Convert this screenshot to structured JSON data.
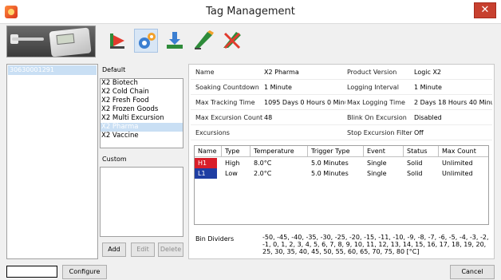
{
  "window": {
    "title": "Tag Management",
    "close_glyph": "✕",
    "app_icon": "app-icon"
  },
  "toolbar": {
    "tools": [
      {
        "name": "chart-icon"
      },
      {
        "name": "settings-icon"
      },
      {
        "name": "download-icon"
      },
      {
        "name": "edit-icon"
      },
      {
        "name": "clear-icon"
      }
    ],
    "active_index": 1
  },
  "tags": {
    "selected": "30630001291"
  },
  "profiles": {
    "default_label": "Default",
    "default_items": [
      "X2 Biotech",
      "X2 Cold Chain",
      "X2 Fresh Food",
      "X2 Frozen Goods",
      "X2 Multi Excursion",
      "X2 Pharma",
      "X2 Vaccine"
    ],
    "selected_index": 5,
    "custom_label": "Custom",
    "add_label": "Add",
    "edit_label": "Edit",
    "delete_label": "Delete"
  },
  "details": {
    "name_label": "Name",
    "name_value": "X2 Pharma",
    "product_version_label": "Product Version",
    "product_version_value": "Logic X2",
    "soaking_label": "Soaking Countdown",
    "soaking_value": "1 Minute",
    "logging_interval_label": "Logging Interval",
    "logging_interval_value": "1 Minute",
    "max_tracking_label": "Max Tracking Time",
    "max_tracking_value": "1095 Days 0 Hours 0 Minut",
    "max_logging_label": "Max Logging Time",
    "max_logging_value": "2 Days 18 Hours 40 Minute",
    "max_excursion_label": "Max Excursion Count",
    "max_excursion_value": "48",
    "blink_label": "Blink On Excursion",
    "blink_value": "Disabled",
    "excursions_label": "Excursions",
    "stop_filter_label": "Stop Excursion Filter",
    "stop_filter_value": "Off"
  },
  "excursion_table": {
    "headers": [
      "Name",
      "Type",
      "Temperature",
      "Trigger Type",
      "Event",
      "Status",
      "Max Count"
    ],
    "rows": [
      {
        "name": "H1",
        "type": "High",
        "temperature": "8.0°C",
        "trigger": "5.0 Minutes",
        "event": "Single",
        "status": "Solid",
        "max_count": "Unlimited"
      },
      {
        "name": "L1",
        "type": "Low",
        "temperature": "2.0°C",
        "trigger": "5.0 Minutes",
        "event": "Single",
        "status": "Solid",
        "max_count": "Unlimited"
      }
    ],
    "colors": {
      "high": "#d81e2a",
      "low": "#1f3ea3"
    }
  },
  "bins": {
    "label": "Bin Dividers",
    "value": "-50, -45, -40, -35, -30, -25, -20, -15, -11, -10, -9, -8, -7, -6, -5, -4, -3, -2, -1, 0, 1, 2, 3, 4, 5, 6, 7, 8, 9, 10, 11, 12, 13, 14, 15, 16, 17, 18, 19, 20, 25, 30, 35, 40, 45, 50, 55, 60, 65, 70, 75, 80 [°C]"
  },
  "footer": {
    "configure_label": "Configure",
    "cancel_label": "Cancel"
  }
}
